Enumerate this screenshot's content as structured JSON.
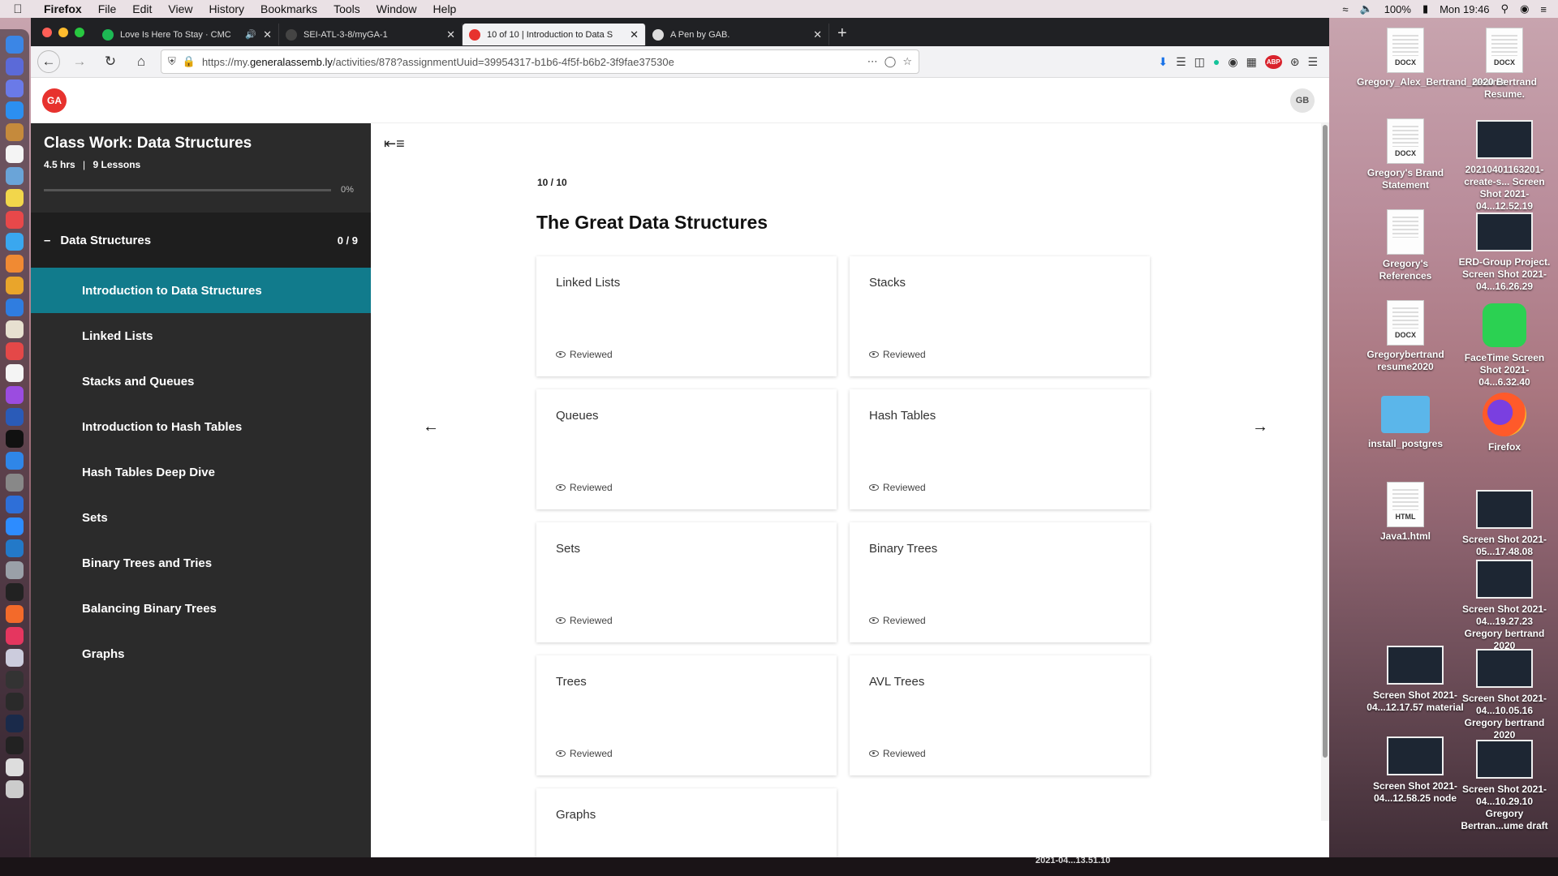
{
  "menubar": {
    "app": "Firefox",
    "items": [
      "File",
      "Edit",
      "View",
      "History",
      "Bookmarks",
      "Tools",
      "Window",
      "Help"
    ],
    "battery": "100%",
    "clock": "Mon 19:46"
  },
  "browser": {
    "tabs": [
      {
        "title": "Love Is Here To Stay · CMC",
        "favicon_color": "#1db954"
      },
      {
        "title": "SEI-ATL-3-8/myGA-1",
        "favicon_color": "#444444"
      },
      {
        "title": "10 of 10 | Introduction to Data S",
        "favicon_color": "#e7322e"
      },
      {
        "title": "A Pen by GAB.",
        "favicon_color": "#dddddd"
      }
    ],
    "url_prefix": "https://my.",
    "url_domain": "generalassemb.ly",
    "url_path": "/activities/878?assignmentUuid=39954317-b1b6-4f5f-b6b2-3f9fae37530e",
    "toolbar_badge": "ABP"
  },
  "ga": {
    "logo": "GA",
    "avatar": "GB",
    "accent": "#117b8c"
  },
  "sidebar": {
    "title": "Class Work: Data Structures",
    "hours": "4.5 hrs",
    "lessons": "9 Lessons",
    "progress_pct": "0%",
    "progress_fraction": 0,
    "section": {
      "label": "Data Structures",
      "count": "0 / 9"
    },
    "items": [
      {
        "label": "Introduction to Data Structures",
        "active": true
      },
      {
        "label": "Linked Lists"
      },
      {
        "label": "Stacks and Queues"
      },
      {
        "label": "Introduction to Hash Tables"
      },
      {
        "label": "Hash Tables Deep Dive"
      },
      {
        "label": "Sets"
      },
      {
        "label": "Binary Trees and Tries"
      },
      {
        "label": "Balancing Binary Trees"
      },
      {
        "label": "Graphs"
      }
    ]
  },
  "main": {
    "counter": "10 / 10",
    "heading": "The Great Data Structures",
    "cards": [
      {
        "title": "Linked Lists",
        "status": "Reviewed"
      },
      {
        "title": "Stacks",
        "status": "Reviewed"
      },
      {
        "title": "Queues",
        "status": "Reviewed"
      },
      {
        "title": "Hash Tables",
        "status": "Reviewed"
      },
      {
        "title": "Sets",
        "status": "Reviewed"
      },
      {
        "title": "Binary Trees",
        "status": "Reviewed"
      },
      {
        "title": "Trees",
        "status": "Reviewed"
      },
      {
        "title": "AVL Trees",
        "status": "Reviewed"
      },
      {
        "title": "Graphs",
        "status": ""
      }
    ]
  },
  "desktop": {
    "icons": [
      {
        "label": "Gregory_Alex_Bertrand_resume",
        "kind": "docx",
        "ext": "DOCX"
      },
      {
        "label": "2020 Bertrand Resume.",
        "kind": "docx",
        "ext": "DOCX"
      },
      {
        "label": "Gregory's Brand Statement",
        "kind": "docx",
        "ext": "DOCX"
      },
      {
        "label": "20210401163201-create-s... Screen Shot 2021-04...12.52.19",
        "kind": "shot"
      },
      {
        "label": "Gregory's References",
        "kind": "doc"
      },
      {
        "label": "ERD-Group Project. Screen Shot 2021-04...16.26.29",
        "kind": "shot"
      },
      {
        "label": "Gregorybertrand resume2020",
        "kind": "docx",
        "ext": "DOCX"
      },
      {
        "label": "FaceTime Screen Shot 2021-04...6.32.40",
        "kind": "facetime"
      },
      {
        "label": "install_postgres",
        "kind": "folder"
      },
      {
        "label": "Firefox",
        "kind": "firefox"
      },
      {
        "label": "Java1.html",
        "kind": "html",
        "ext": "HTML"
      },
      {
        "label": "Screen Shot 2021-05...17.48.08",
        "kind": "shot"
      },
      {
        "label": "Screen Shot 2021-04...19.27.23 Gregory bertrand 2020",
        "kind": "shot"
      },
      {
        "label": "Screen Shot 2021-04...12.17.57 material",
        "kind": "shot"
      },
      {
        "label": "Screen Shot 2021-04...10.05.16 Gregory bertrand 2020",
        "kind": "shot"
      },
      {
        "label": "Screen Shot 2021-04...12.58.25 node",
        "kind": "shot"
      },
      {
        "label": "Screen Shot 2021-04...10.29.10 Gregory Bertran...ume draft",
        "kind": "shot"
      }
    ],
    "bottom_label": "2021-04...13.51.10"
  }
}
